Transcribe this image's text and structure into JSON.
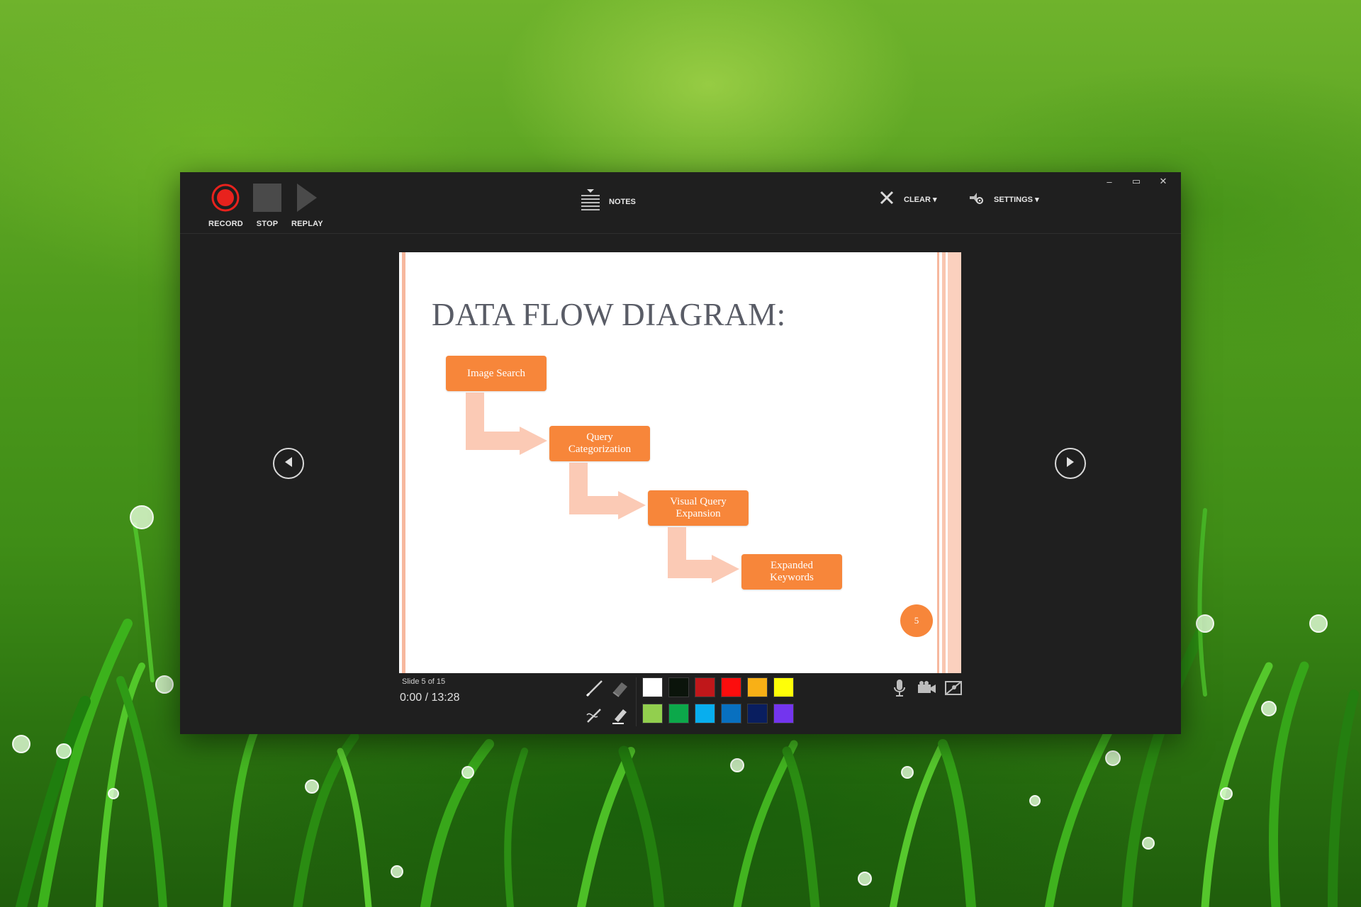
{
  "window": {
    "controls": {
      "minimize": "–",
      "restore": "▭",
      "close": "✕"
    }
  },
  "toolbar": {
    "record_label": "RECORD",
    "stop_label": "STOP",
    "replay_label": "REPLAY",
    "notes_label": "NOTES",
    "clear_label": "CLEAR",
    "settings_label": "SETTINGS",
    "dropdown_arrow": "▾"
  },
  "slide": {
    "title": "DATA FLOW DIAGRAM:",
    "boxes": [
      {
        "label": "Image Search"
      },
      {
        "label": "Query\nCategorization"
      },
      {
        "label": "Visual Query\nExpansion"
      },
      {
        "label": "Expanded\nKeywords"
      }
    ],
    "page_number": "5",
    "accent_color": "#f7863a",
    "arrow_color": "#fbcab5"
  },
  "footer": {
    "slide_count": "Slide 5 of 15",
    "time_current": "0:00",
    "time_separator": "/",
    "time_total": "13:28"
  },
  "palette": [
    {
      "name": "white",
      "color": "#ffffff"
    },
    {
      "name": "black",
      "color": "#0b140b"
    },
    {
      "name": "dark-red",
      "color": "#c0171a"
    },
    {
      "name": "red",
      "color": "#fc0d0d"
    },
    {
      "name": "orange",
      "color": "#f8b016"
    },
    {
      "name": "yellow",
      "color": "#fefe08"
    },
    {
      "name": "light-green",
      "color": "#92cf4e"
    },
    {
      "name": "green",
      "color": "#0ca84a"
    },
    {
      "name": "light-blue",
      "color": "#08aeee"
    },
    {
      "name": "blue",
      "color": "#0870c0"
    },
    {
      "name": "dark-blue",
      "color": "#091e5f"
    },
    {
      "name": "purple",
      "color": "#7335ee"
    }
  ],
  "icons": {
    "record": "record-icon",
    "stop": "stop-icon",
    "replay": "play-icon",
    "notes": "notes-icon",
    "clear": "x-icon",
    "settings": "gear-icon",
    "prev": "previous-slide-icon",
    "next": "next-slide-icon",
    "pen": "pen-icon",
    "eraser": "eraser-icon",
    "laser": "laser-pointer-icon",
    "highlighter": "highlighter-icon",
    "mic": "microphone-icon",
    "camera": "video-camera-icon",
    "preview": "camera-preview-icon"
  }
}
